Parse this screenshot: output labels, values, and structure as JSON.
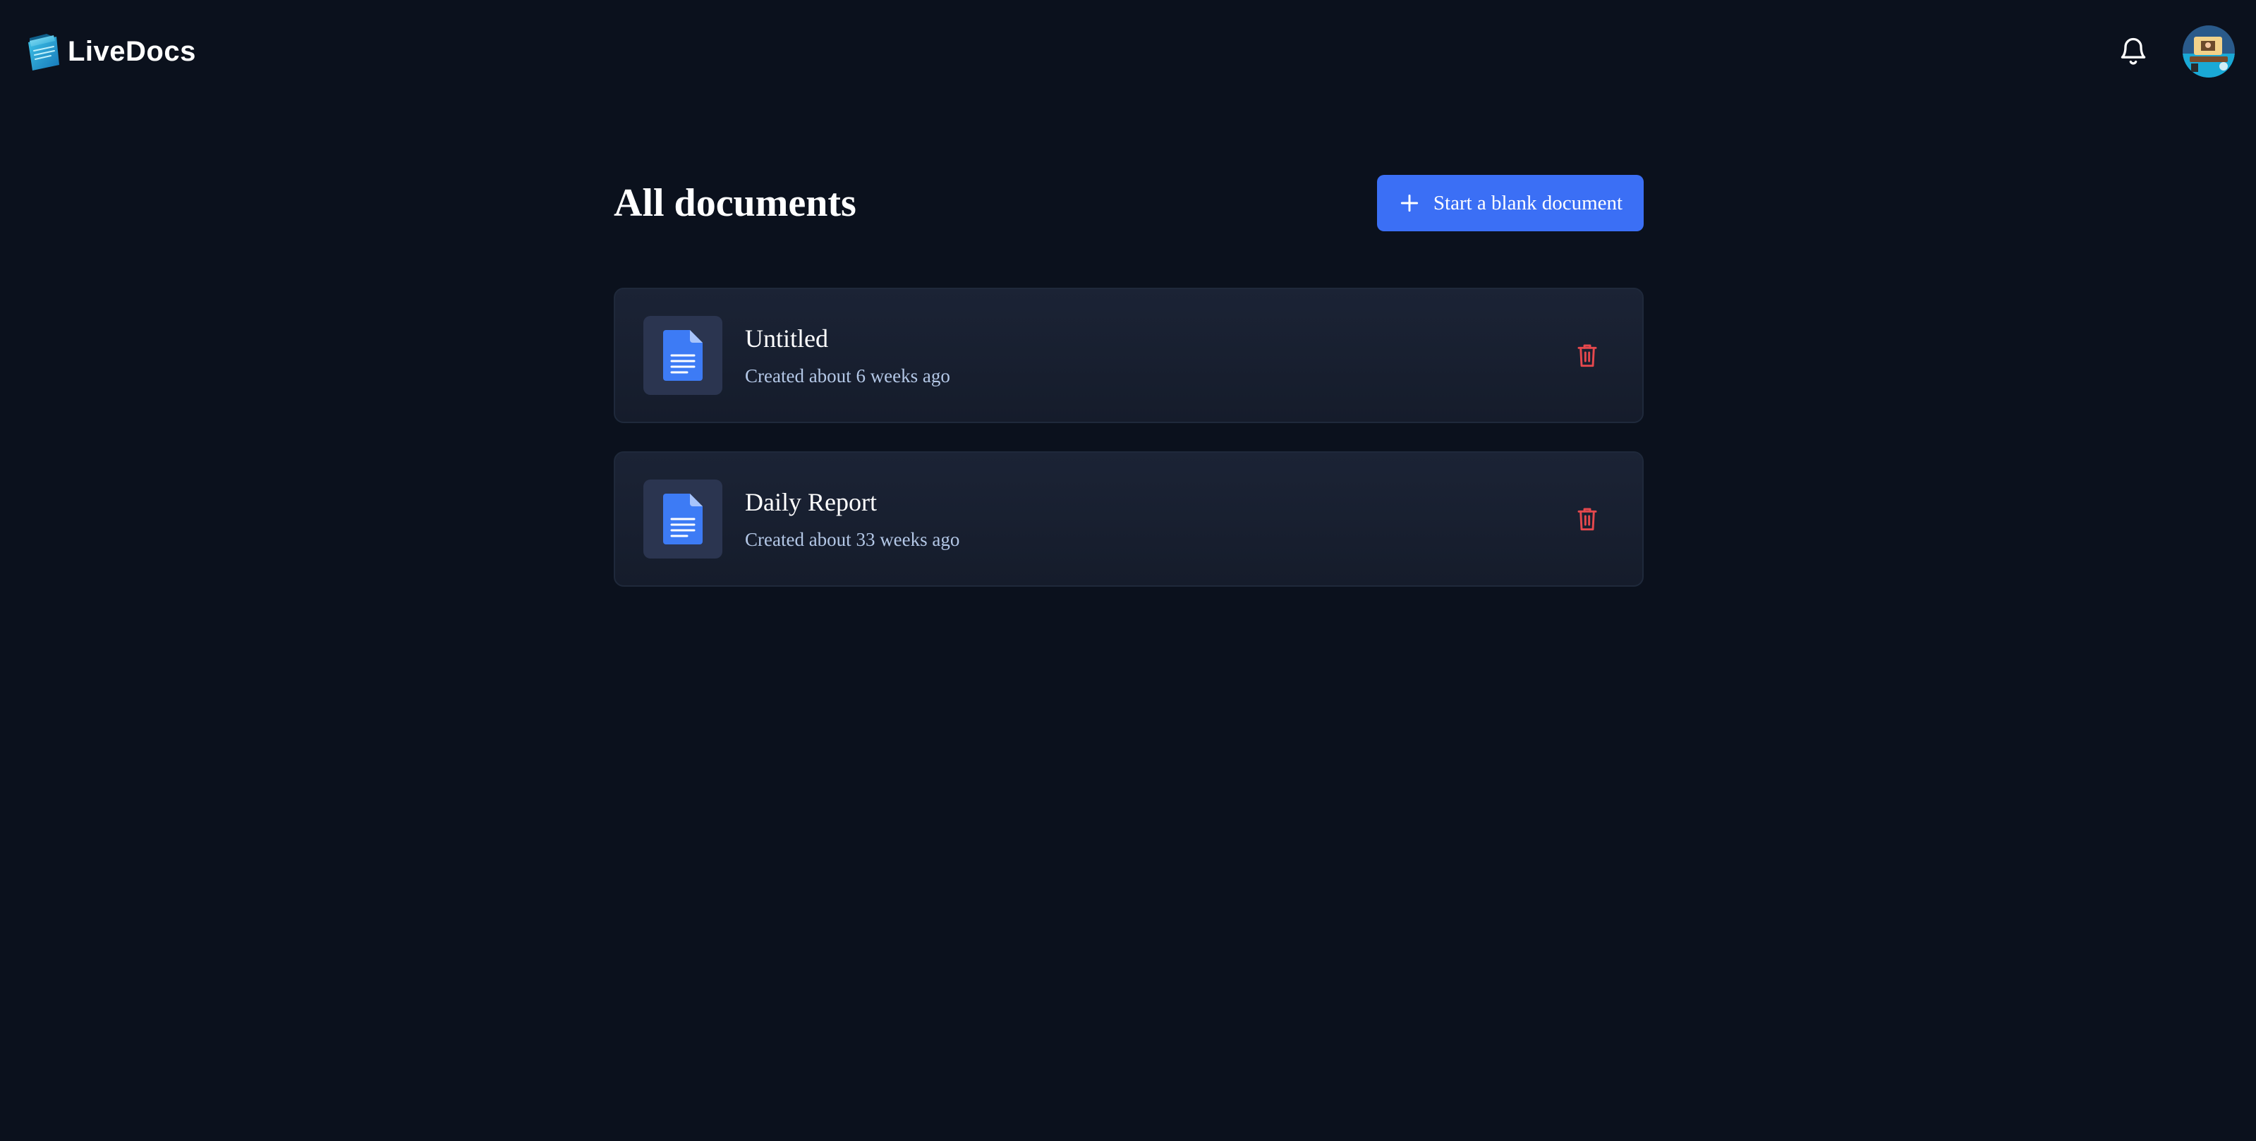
{
  "app": {
    "name": "LiveDocs",
    "logo_icon": "folder-docs-icon"
  },
  "header": {
    "notification_icon": "bell-icon",
    "avatar_icon": "user-avatar"
  },
  "main": {
    "title": "All documents",
    "new_button": {
      "label": "Start a blank document",
      "icon": "plus-icon"
    },
    "documents": [
      {
        "title": "Untitled",
        "meta": "Created about 6 weeks ago",
        "icon": "document-icon",
        "action_icon": "trash-icon"
      },
      {
        "title": "Daily Report",
        "meta": "Created about 33 weeks ago",
        "icon": "document-icon",
        "action_icon": "trash-icon"
      }
    ]
  },
  "colors": {
    "background": "#0b111d",
    "accent": "#3b6ff5",
    "card": "#1b2335",
    "danger": "#e5484d",
    "muted_text": "#b3c7e6"
  }
}
